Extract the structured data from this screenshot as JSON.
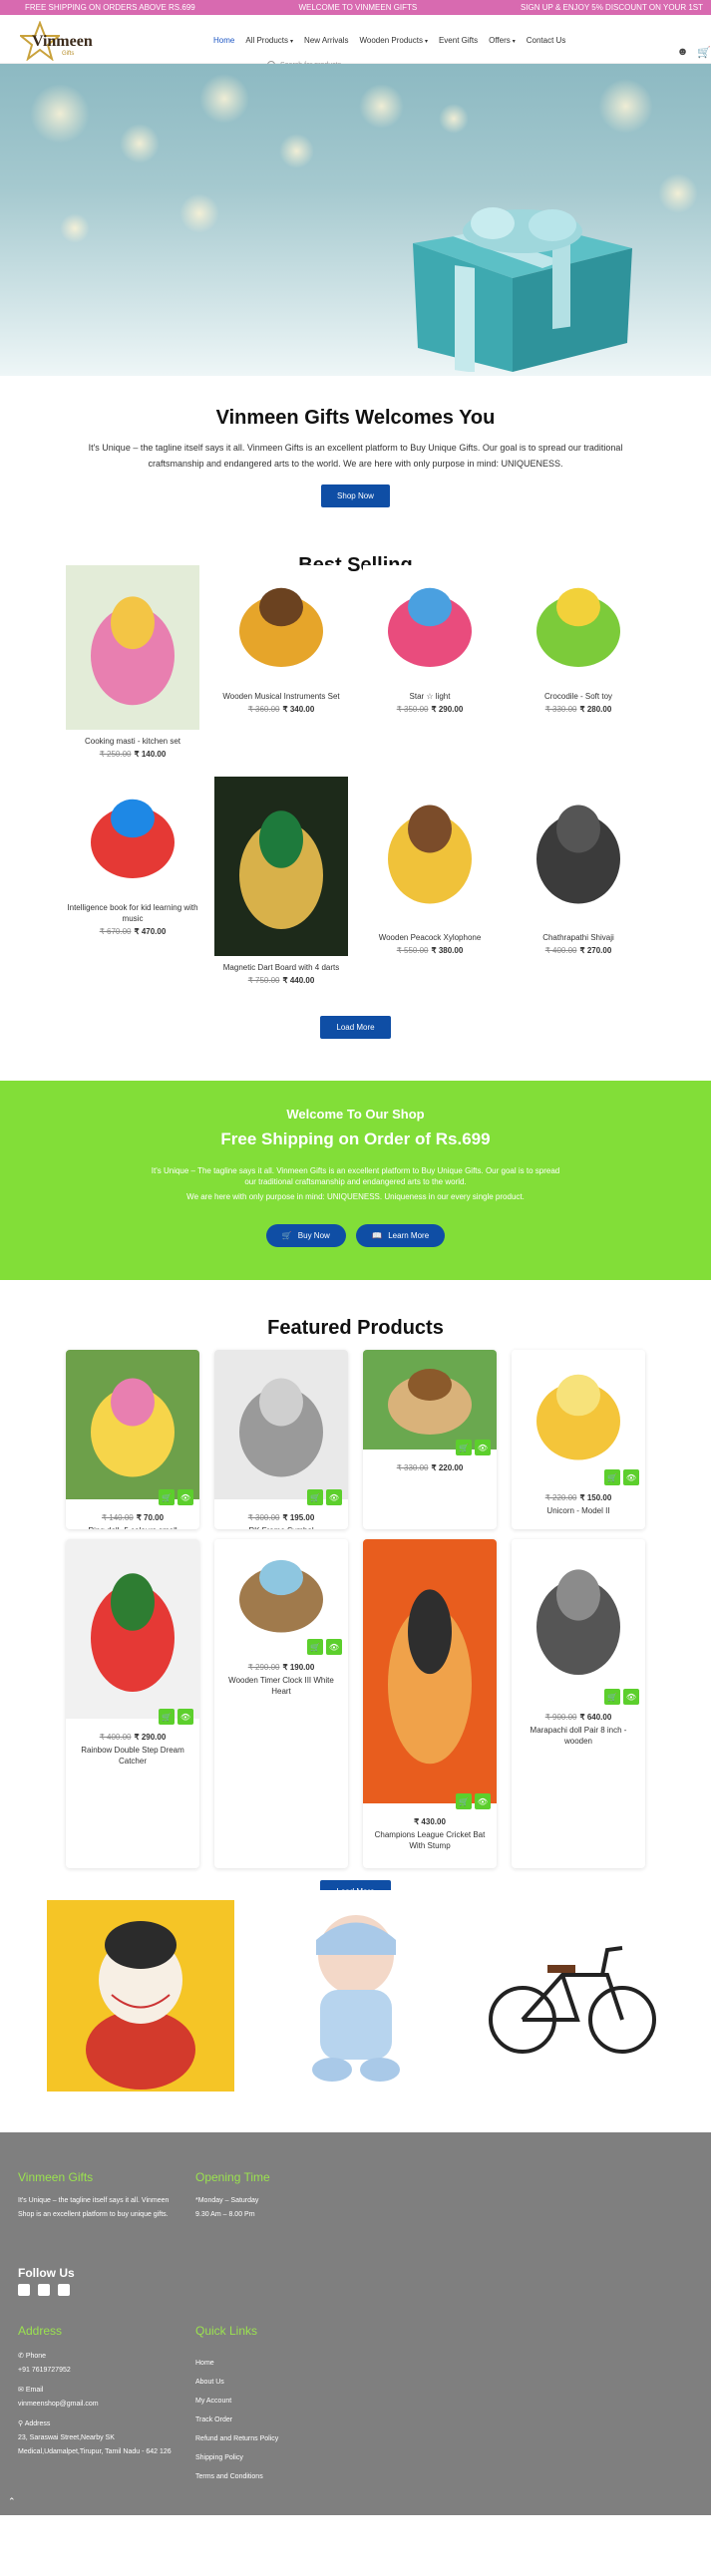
{
  "topbar": {
    "left": "FREE SHIPPING ON ORDERS ABOVE RS.699",
    "center": "WELCOME TO VINMEEN GIFTS",
    "right": "SIGN UP & ENJOY 5% DISCOUNT ON YOUR 1ST"
  },
  "brand": {
    "name": "Vinmeen",
    "sub": "Gifts",
    "color": "#b8902c"
  },
  "nav": {
    "items": [
      {
        "label": "Home",
        "active": true,
        "dropdown": false
      },
      {
        "label": "All Products",
        "active": false,
        "dropdown": true
      },
      {
        "label": "New Arrivals",
        "active": false,
        "dropdown": false
      },
      {
        "label": "Wooden Products",
        "active": false,
        "dropdown": true
      },
      {
        "label": "Event Gifts",
        "active": false,
        "dropdown": false
      },
      {
        "label": "Offers",
        "active": false,
        "dropdown": true
      },
      {
        "label": "Contact Us",
        "active": false,
        "dropdown": false
      }
    ],
    "search_placeholder": "Search for products",
    "icons": [
      "user-icon",
      "cart-icon"
    ]
  },
  "welcome": {
    "title": "Vinmeen Gifts Welcomes You",
    "text": "It's Unique – the tagline itself says it all. Vinmeen Gifts is an excellent platform to Buy Unique Gifts. Our goal is to spread our traditional craftsmanship and endangered arts to the world. We are here with only purpose in mind: UNIQUENESS.",
    "button": "Shop Now"
  },
  "best_selling": {
    "title": "Best Selling",
    "products": [
      {
        "name": "Cooking masti - kitchen set",
        "old": "₹ 250.00",
        "price": "₹ 140.00"
      },
      {
        "name": "Wooden Musical Instruments Set",
        "old": "₹ 360.00",
        "price": "₹ 340.00"
      },
      {
        "name": "Star ☆ light",
        "old": "₹ 350.00",
        "price": "₹ 290.00"
      },
      {
        "name": "Crocodile - Soft toy",
        "old": "₹ 330.00",
        "price": "₹ 280.00"
      },
      {
        "name": "Intelligence book for kid learning with music",
        "old": "₹ 670.00",
        "price": "₹ 470.00"
      },
      {
        "name": "Magnetic Dart Board with 4 darts",
        "old": "₹ 750.00",
        "price": "₹ 440.00"
      },
      {
        "name": "Wooden Peacock Xylophone",
        "old": "₹ 550.00",
        "price": "₹ 380.00"
      },
      {
        "name": "Chathrapathi Shivaji",
        "old": "₹ 400.00",
        "price": "₹ 270.00"
      }
    ],
    "button": "Load More"
  },
  "shop_banner": {
    "heading": "Welcome To Our Shop",
    "subheading": "Free Shipping on Order of Rs.699",
    "text1": "It's Unique – The tagline says it all. Vinmeen Gifts is an excellent platform to Buy Unique Gifts. Our goal is to spread our traditional craftsmanship and endangered arts to the world.",
    "text2": "We are here with only purpose in mind: UNIQUENESS. Uniqueness in our every single product.",
    "buy_button": "Buy Now",
    "learn_button": "Learn More",
    "bg_color": "#82de38"
  },
  "featured": {
    "title": "Featured Products",
    "products": [
      {
        "name": "Ring doll -5 colours small",
        "old": "₹ 140.00",
        "price": "₹ 70.00"
      },
      {
        "name": "RK Frame Symbol",
        "old": "₹ 300.00",
        "price": "₹ 195.00"
      },
      {
        "name": "",
        "old": "₹ 330.00",
        "price": "₹ 220.00"
      },
      {
        "name": "Unicorn - Model II",
        "old": "₹ 220.00",
        "price": "₹ 150.00"
      },
      {
        "name": "Rainbow Double Step Dream Catcher",
        "old": "₹ 400.00",
        "price": "₹ 290.00"
      },
      {
        "name": "Wooden Timer Clock III White Heart",
        "old": "₹ 290.00",
        "price": "₹ 190.00"
      },
      {
        "name": "Champions League Cricket Bat With Stump",
        "old": "",
        "price": "₹ 430.00"
      },
      {
        "name": "Marapachi doll Pair 8 inch - wooden",
        "old": "₹ 900.00",
        "price": "₹ 640.00"
      }
    ],
    "button": "Load More"
  },
  "footer": {
    "col1_title": "Vinmeen Gifts",
    "col1_text": "It's Unique – the tagline itself says it all. Vinmeen Shop is an excellent platform to buy unique gifts.",
    "col2_title": "Opening Time",
    "col2_days": "*Monday – Saturday",
    "col2_hours": "9.30 Am – 8.00 Pm",
    "follow": "Follow Us",
    "address_title": "Address",
    "phone_label": "Phone",
    "phone": "+91 7619727952",
    "email_label": "Email",
    "email": "vinmeenshop@gmail.com",
    "addr_label": "Address",
    "address": "23, Saraswai Street,Nearby SK Medical,Udamalpet,Tirupur, Tamil Nadu - 642 126",
    "links_title": "Quick Links",
    "links": [
      "Home",
      "About Us",
      "My Account",
      "Track Order",
      "Refund and Returns Policy",
      "Shipping Policy",
      "Terms and Conditions"
    ]
  }
}
